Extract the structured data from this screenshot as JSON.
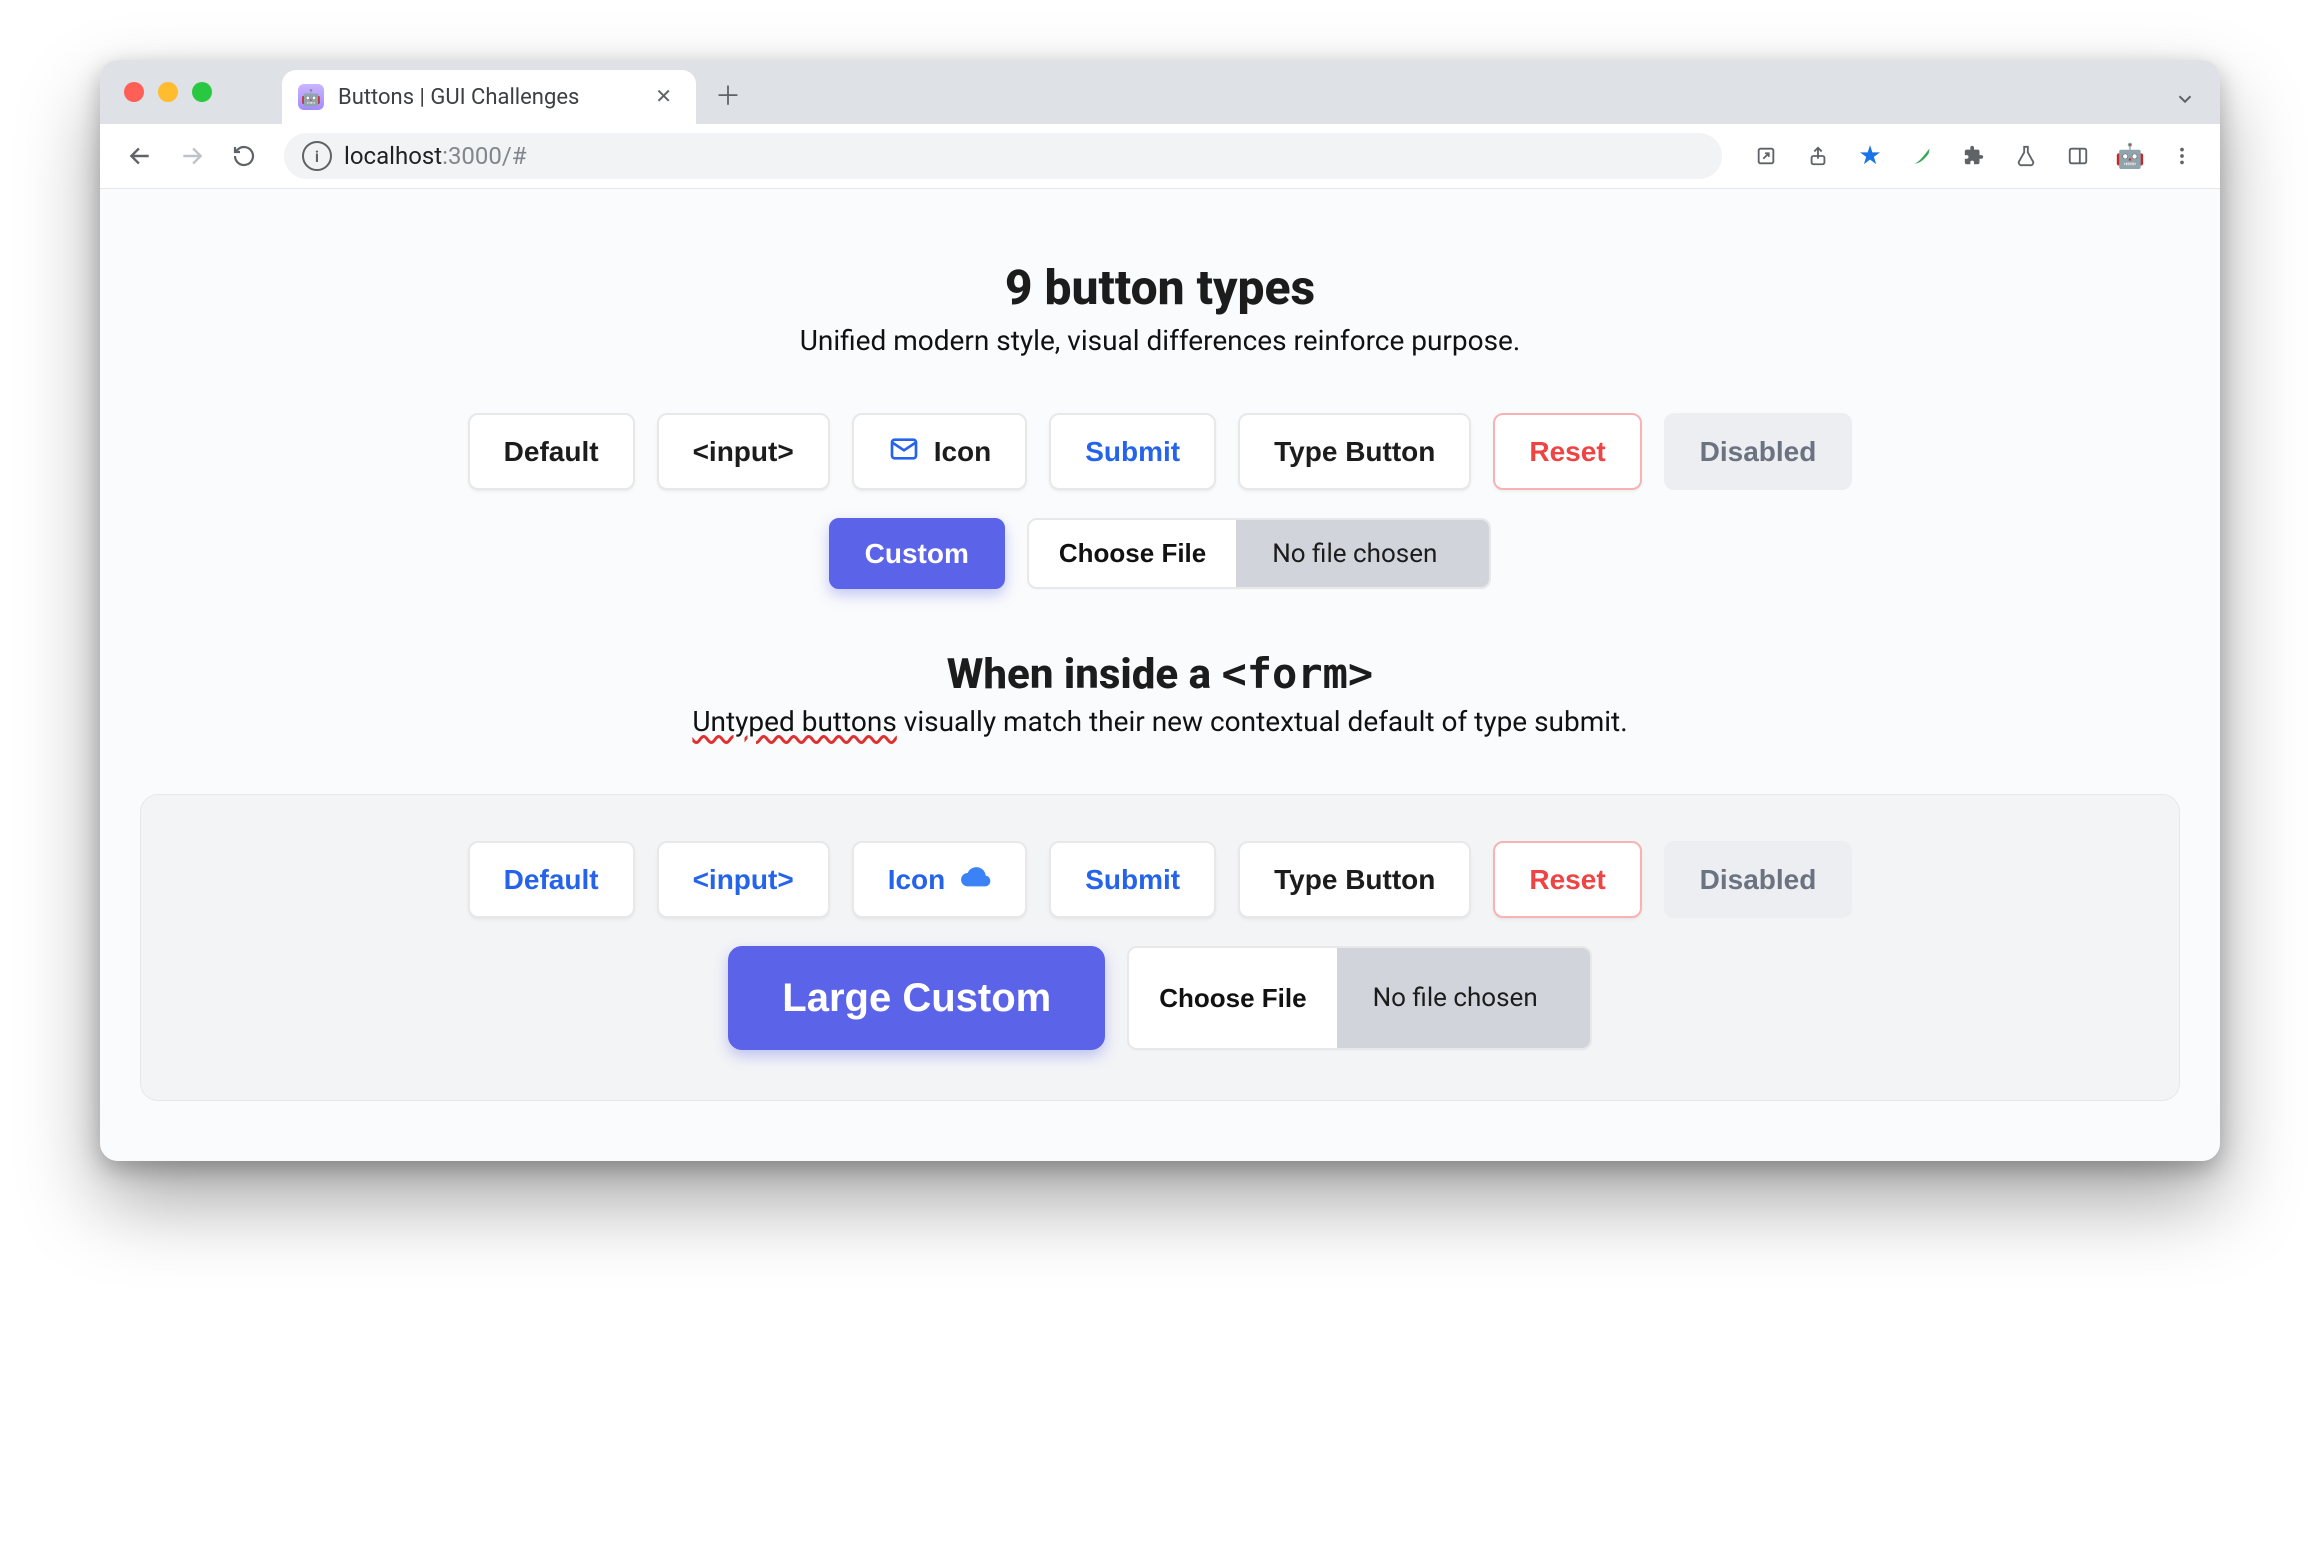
{
  "browser": {
    "tab_title": "Buttons | GUI Challenges",
    "url_host": "localhost",
    "url_port_path": ":3000/#"
  },
  "section1": {
    "heading": "9 button types",
    "subtitle": "Unified modern style, visual differences reinforce purpose.",
    "buttons": {
      "default": "Default",
      "input": "<input>",
      "icon": "Icon",
      "submit": "Submit",
      "type_button": "Type Button",
      "reset": "Reset",
      "disabled": "Disabled",
      "custom": "Custom"
    },
    "file": {
      "choose": "Choose File",
      "status": "No file chosen"
    }
  },
  "section2": {
    "heading_prefix": "When inside a ",
    "heading_code": "<form>",
    "subtitle_squiggle": "Untyped buttons",
    "subtitle_rest": " visually match their new contextual default of type submit.",
    "buttons": {
      "default": "Default",
      "input": "<input>",
      "icon": "Icon",
      "submit": "Submit",
      "type_button": "Type Button",
      "reset": "Reset",
      "disabled": "Disabled",
      "custom": "Large Custom"
    },
    "file": {
      "choose": "Choose File",
      "status": "No file chosen"
    }
  }
}
